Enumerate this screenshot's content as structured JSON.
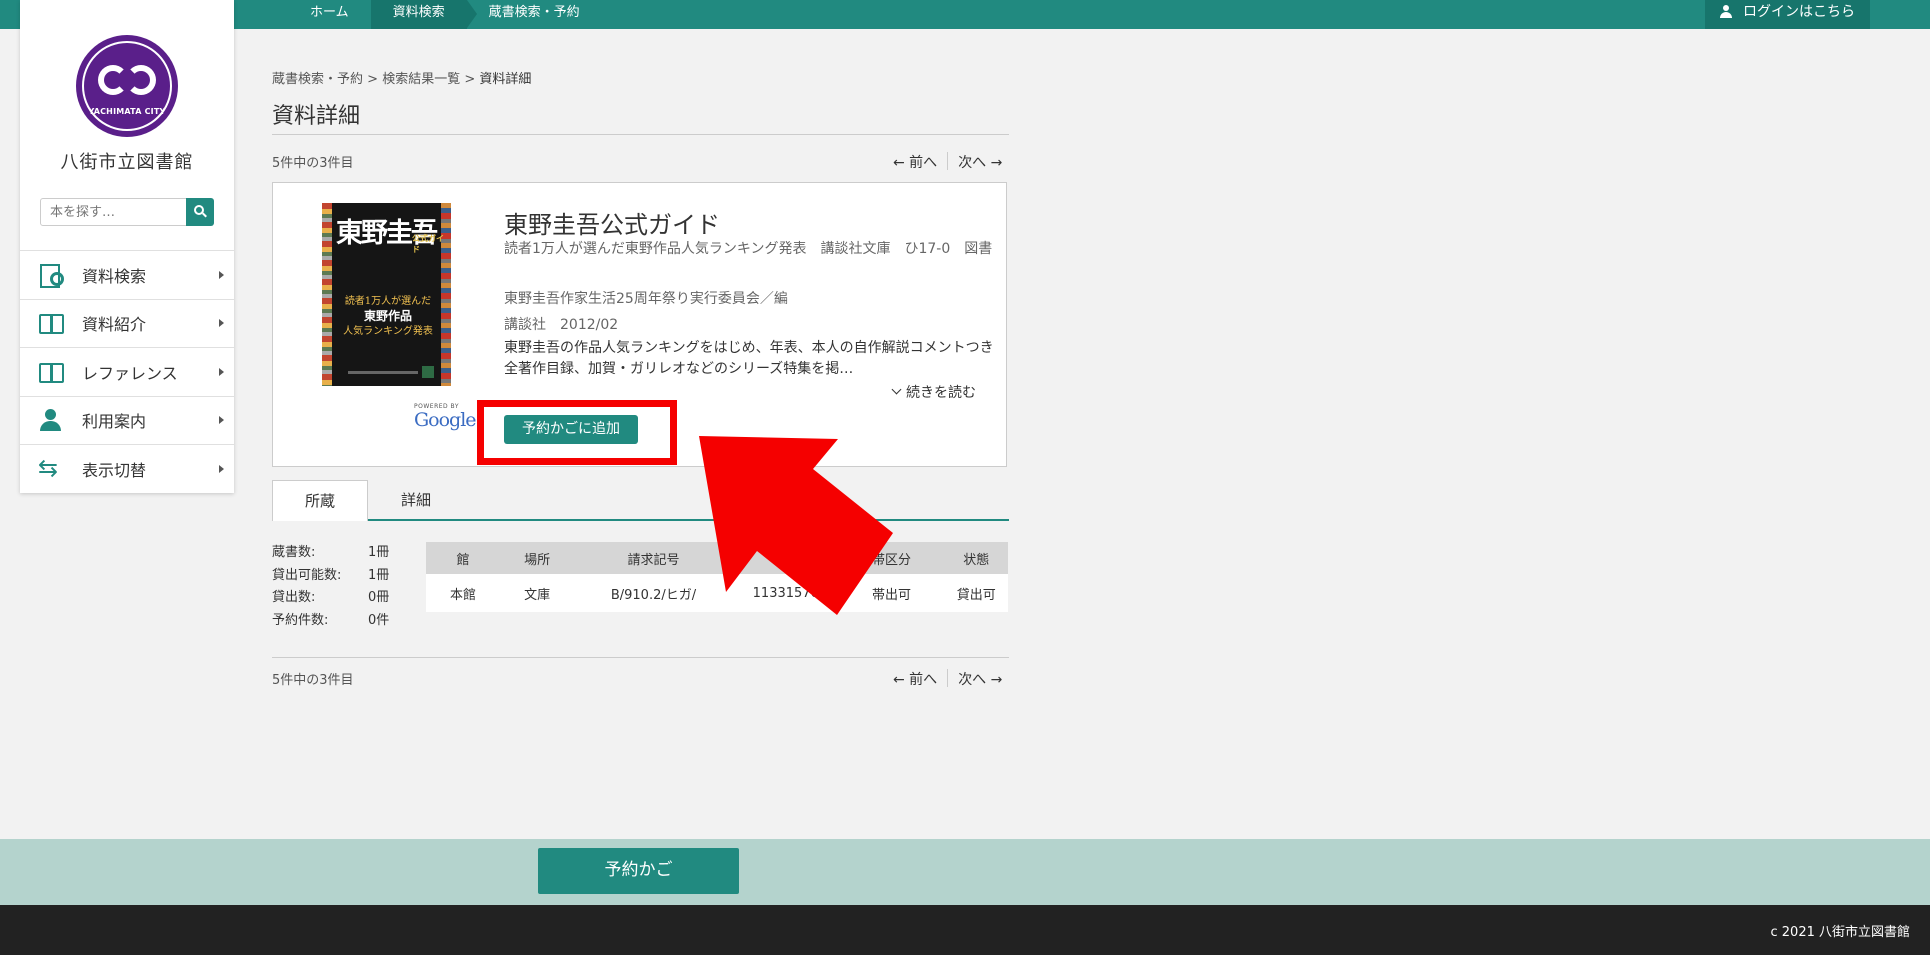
{
  "topbar": {
    "crumbs": [
      "ホーム",
      "資料検索",
      "蔵書検索・予約"
    ],
    "login": "ログインはこちら"
  },
  "sidebar": {
    "logo_text": "YACHIMATA CITY",
    "library_name": "八街市立図書館",
    "search_placeholder": "本を探す…",
    "items": [
      {
        "label": "資料検索",
        "icon": "search-icon"
      },
      {
        "label": "資料紹介",
        "icon": "book-icon"
      },
      {
        "label": "レファレンス",
        "icon": "book-icon"
      },
      {
        "label": "利用案内",
        "icon": "user-icon"
      },
      {
        "label": "表示切替",
        "icon": "swap-icon"
      }
    ]
  },
  "breadcrumb": {
    "a": "蔵書検索・予約",
    "b": "検索結果一覧",
    "c": "資料詳細",
    "sep": ">"
  },
  "page_title": "資料詳細",
  "pager": {
    "count": "5件中の3件目",
    "prev": "← 前へ",
    "next": "次へ →"
  },
  "book": {
    "title": "東野圭吾公式ガイド",
    "subtitle": "読者1万人が選んだ東野作品人気ランキング発表　講談社文庫　ひ17-0　図書",
    "author": "東野圭吾作家生活25周年祭り実行委員会／編",
    "publisher": "講談社　2012/02",
    "description": "東野圭吾の作品人気ランキングをはじめ、年表、本人の自作解説コメントつき全著作目録、加賀・ガリレオなどのシリーズ特集を掲…",
    "read_more": "続きを読む",
    "reserve_button": "予約かごに追加",
    "cover": {
      "title": "東野圭吾",
      "small": "公式ガイド",
      "line1": "読者1万人が選んだ",
      "line2": "東野作品",
      "line3": "人気ランキング発表"
    },
    "powered_by": "POWERED BY",
    "google": "Google"
  },
  "tabs": [
    "所蔵",
    "詳細"
  ],
  "holdings": {
    "stats": [
      {
        "label": "蔵書数:",
        "value": "1冊"
      },
      {
        "label": "貸出可能数:",
        "value": "1冊"
      },
      {
        "label": "貸出数:",
        "value": "0冊"
      },
      {
        "label": "予約件数:",
        "value": "0件"
      }
    ],
    "columns": [
      "館",
      "場所",
      "請求記号",
      "",
      "帯区分",
      "状態"
    ],
    "rows": [
      [
        "本館",
        "文庫",
        "B/910.2/ヒガ/",
        "11331576",
        "帯出可",
        "貸出可"
      ]
    ]
  },
  "bottom": {
    "cart_button": "予約かご",
    "copyright": "c 2021 八街市立図書館"
  },
  "colors": {
    "brand": "#218a80",
    "annotation": "#f50000"
  }
}
